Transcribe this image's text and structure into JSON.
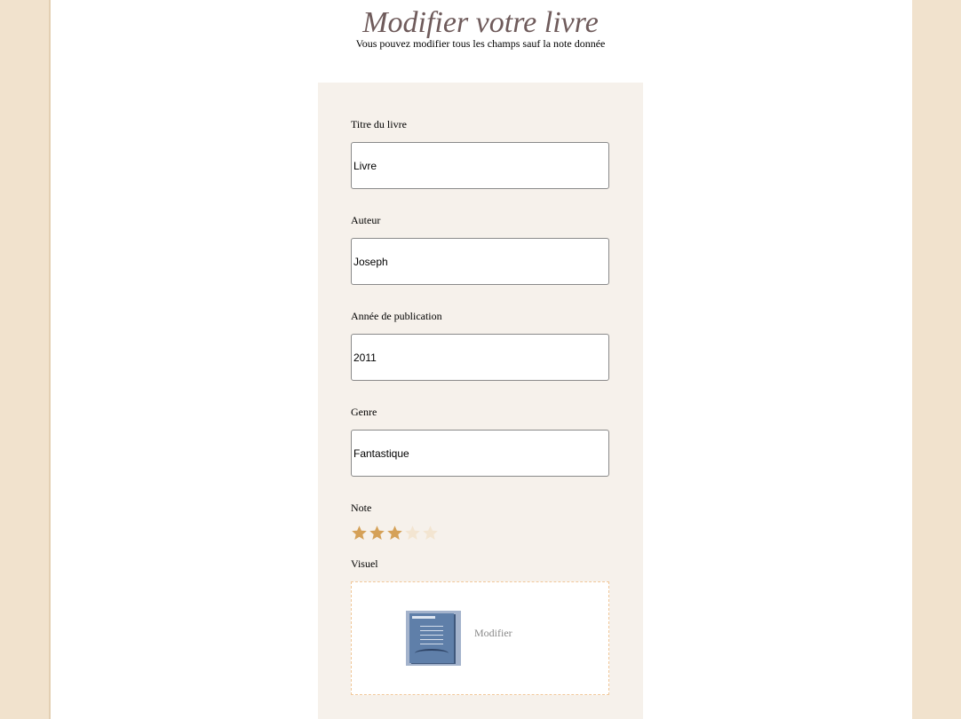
{
  "header": {
    "title": "Modifier votre livre",
    "subtitle": "Vous pouvez modifier tous les champs sauf la note donnée"
  },
  "form": {
    "fields": [
      {
        "label": "Titre du livre",
        "value": "Livre"
      },
      {
        "label": "Auteur",
        "value": "Joseph"
      },
      {
        "label": "Année de publication",
        "value": "2011"
      },
      {
        "label": "Genre",
        "value": "Fantastique"
      }
    ],
    "rating": {
      "label": "Note",
      "value": 3,
      "max": 5,
      "filled_color": "#d5a158",
      "empty_color": "#f3e5d1"
    },
    "visual": {
      "label": "Visuel",
      "modify_label": "Modifier"
    }
  },
  "colors": {
    "background": "#f1e2cd",
    "panel": "#f6f1eb",
    "title": "#6f5b5b",
    "upload_border": "#f1c89a"
  }
}
